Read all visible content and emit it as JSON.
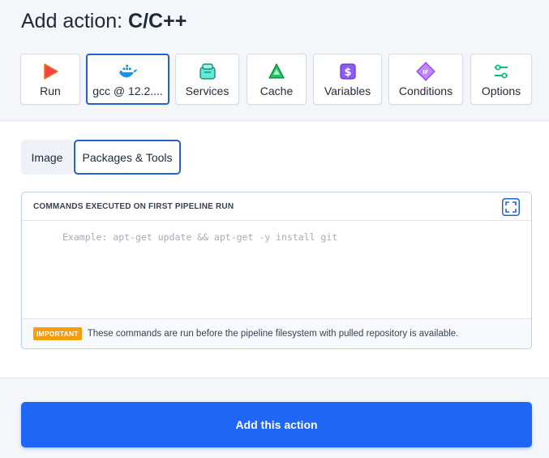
{
  "header": {
    "title_prefix": "Add action:",
    "title_lang": "C/C++"
  },
  "tabs": [
    {
      "label": "Run",
      "icon": "play-icon",
      "color": "#ef4444"
    },
    {
      "label": "gcc @ 12.2....",
      "icon": "docker-icon",
      "color": "#1d91e6",
      "active": true
    },
    {
      "label": "Services",
      "icon": "services-icon",
      "color": "#2dd4bf"
    },
    {
      "label": "Cache",
      "icon": "cache-icon",
      "color": "#22c55e"
    },
    {
      "label": "Variables",
      "icon": "dollar-icon",
      "color": "#8b5cf6"
    },
    {
      "label": "Conditions",
      "icon": "if-icon",
      "color": "#a855f7"
    },
    {
      "label": "Options",
      "icon": "sliders-icon",
      "color": "#10b981"
    }
  ],
  "subtabs": [
    {
      "label": "Image",
      "active": false
    },
    {
      "label": "Packages & Tools",
      "active": true
    }
  ],
  "commands": {
    "header": "COMMANDS EXECUTED ON FIRST PIPELINE RUN",
    "value": "",
    "placeholder": "Example: apt-get update && apt-get -y install git",
    "badge": "IMPORTANT",
    "note": "These commands are run before the pipeline filesystem with pulled repository is available."
  },
  "action": {
    "submit_label": "Add this action"
  },
  "colors": {
    "accent": "#1f66f5",
    "active_border": "#2563c9",
    "warning": "#f59e0b"
  }
}
